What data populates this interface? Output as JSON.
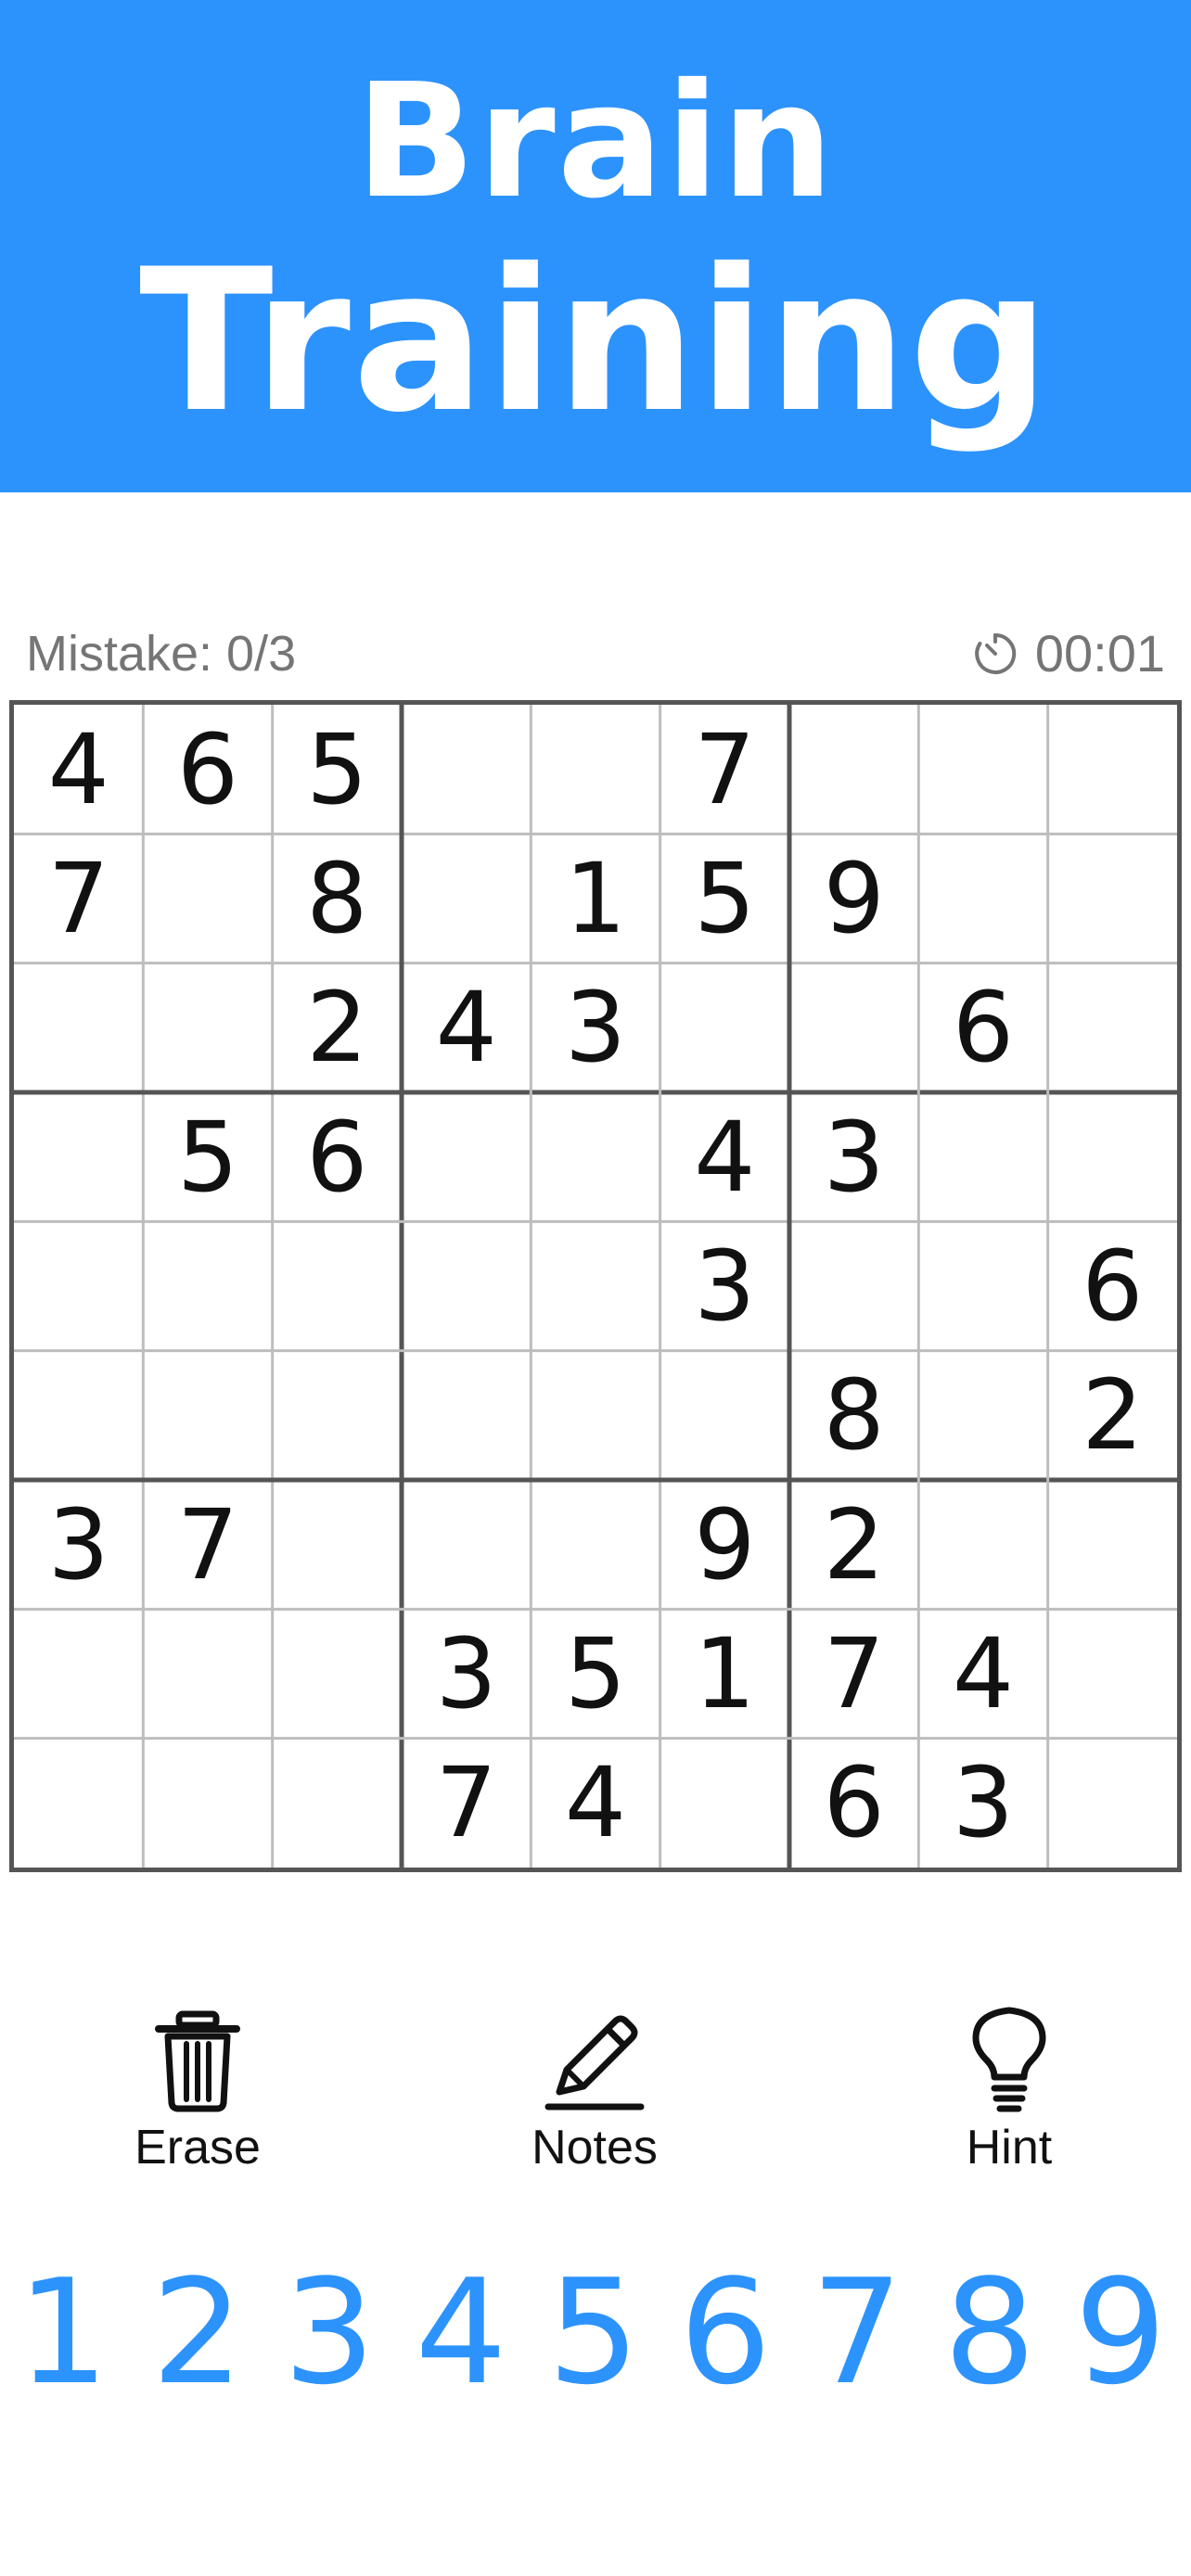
{
  "header": {
    "title_line1": "Brain",
    "title_line2": "Training",
    "bg_color": "#2d93fc"
  },
  "status": {
    "mistake_label": "Mistake: 0/3",
    "timer_icon": "timer-icon",
    "timer": "00:01"
  },
  "board": {
    "cells": [
      [
        "4",
        "6",
        "5",
        "",
        "",
        "7",
        "",
        "",
        ""
      ],
      [
        "7",
        "",
        "8",
        "",
        "1",
        "5",
        "9",
        "",
        ""
      ],
      [
        "",
        "",
        "2",
        "4",
        "3",
        "",
        "",
        "6",
        ""
      ],
      [
        "",
        "5",
        "6",
        "",
        "",
        "4",
        "3",
        "",
        ""
      ],
      [
        "",
        "",
        "",
        "",
        "",
        "3",
        "",
        "",
        "6"
      ],
      [
        "",
        "",
        "",
        "",
        "",
        "",
        "8",
        "",
        "2"
      ],
      [
        "3",
        "7",
        "",
        "",
        "",
        "9",
        "2",
        "",
        ""
      ],
      [
        "",
        "",
        "",
        "3",
        "5",
        "1",
        "7",
        "4",
        ""
      ],
      [
        "",
        "",
        "",
        "7",
        "4",
        "",
        "6",
        "3",
        ""
      ]
    ]
  },
  "tools": [
    {
      "label": "Erase",
      "icon": "trash-icon"
    },
    {
      "label": "Notes",
      "icon": "pencil-icon"
    },
    {
      "label": "Hint",
      "icon": "lightbulb-icon"
    }
  ],
  "numpad": [
    "1",
    "2",
    "3",
    "4",
    "5",
    "6",
    "7",
    "8",
    "9"
  ],
  "colors": {
    "accent": "#2d93fc",
    "grid_thick": "#555555",
    "grid_thin": "#bdbdbd"
  }
}
